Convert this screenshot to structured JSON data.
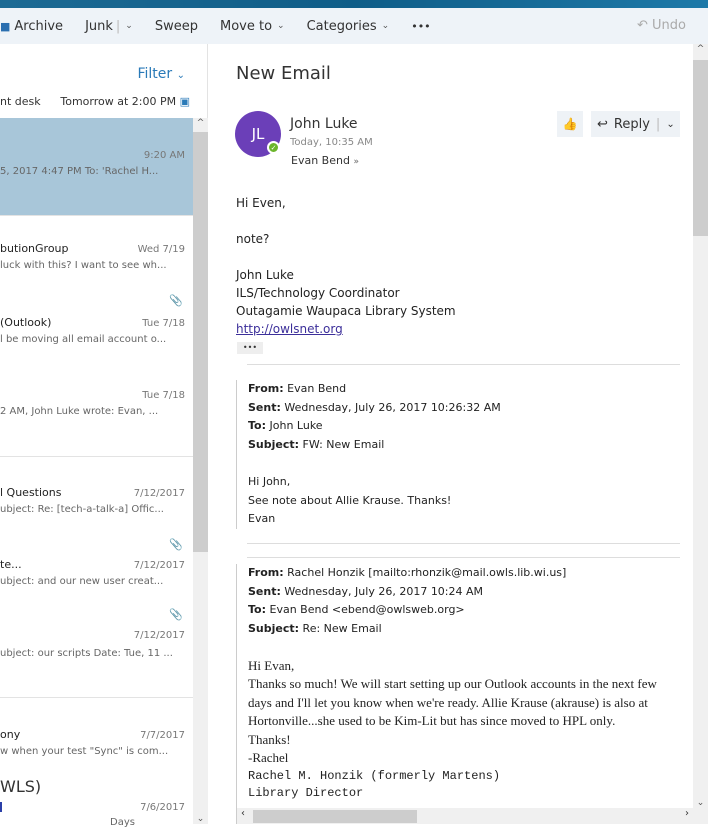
{
  "toolbar": {
    "archive": "Archive",
    "junk": "Junk",
    "sweep": "Sweep",
    "move_to": "Move to",
    "categories": "Categories",
    "more": "•••",
    "undo": "Undo"
  },
  "list": {
    "filter": "Filter",
    "pinned_from": "nt desk",
    "pinned_when": "Tomorrow at 2:00 PM",
    "items": [
      {
        "from": "",
        "date": "9:20 AM",
        "preview": "5, 2017 4:47 PM To: 'Rachel H..."
      },
      {
        "from": "butionGroup",
        "date": "Wed 7/19",
        "preview": "luck with this? I want to see wh..."
      },
      {
        "from": "(Outlook)",
        "date": "Tue 7/18",
        "preview": "l be moving all email account o..."
      },
      {
        "from": "",
        "date": "Tue 7/18",
        "preview": "2 AM, John Luke wrote: Evan, ..."
      },
      {
        "from": "l Questions",
        "date": "7/12/2017",
        "preview": "ubject: Re: [tech-a-talk-a] Offic..."
      },
      {
        "from": "te...",
        "date": "7/12/2017",
        "preview": "ubject: and our new user creat..."
      },
      {
        "from": "",
        "date": "7/12/2017",
        "preview": "ubject: our scripts Date: Tue, 11 ..."
      },
      {
        "from": "ony",
        "date": "7/7/2017",
        "preview": "w when your test \"Sync\" is com..."
      },
      {
        "from": "",
        "date": "7/6/2017",
        "preview": "Days"
      }
    ],
    "group_heading": "WLS)"
  },
  "email": {
    "subject": "New Email",
    "initials": "JL",
    "sender": "John Luke",
    "time": "Today, 10:35 AM",
    "to": "Evan Bend",
    "reply": "Reply",
    "greeting": "Hi Even,",
    "line": "note?",
    "sig_name": "John Luke",
    "sig_title": "ILS/Technology Coordinator",
    "sig_org": "Outagamie Waupaca Library System",
    "sig_link": "http://owlsnet.org",
    "ellipsis": "•••",
    "q1": {
      "from_l": "From:",
      "from": "Evan Bend",
      "sent_l": "Sent:",
      "sent": "Wednesday, July 26, 2017 10:26:32 AM",
      "to_l": "To:",
      "to": "John Luke",
      "subj_l": "Subject:",
      "subj": "FW: New Email",
      "b1": "Hi John,",
      "b2": "See note about Allie Krause. Thanks!",
      "b3": "Evan"
    },
    "q2": {
      "from_l": "From:",
      "from": "Rachel Honzik [mailto:rhonzik@mail.owls.lib.wi.us]",
      "sent_l": "Sent:",
      "sent": "Wednesday, July 26, 2017 10:24 AM",
      "to_l": "To:",
      "to": "Evan Bend <ebend@owlsweb.org>",
      "subj_l": "Subject:",
      "subj": "Re: New Email",
      "b1": "Hi Evan,",
      "b2": "Thanks so much!   We will start setting up our Outlook accounts in the next few days and I'll let you know when we're ready.   Allie Krause (akrause) is also at Hortonville...she used to be Kim-Lit but has since moved to HPL only.",
      "b3": "Thanks!",
      "b4": "-Rachel",
      "b5": "Rachel M. Honzik (formerly Martens)",
      "b6": "Library Director"
    }
  }
}
